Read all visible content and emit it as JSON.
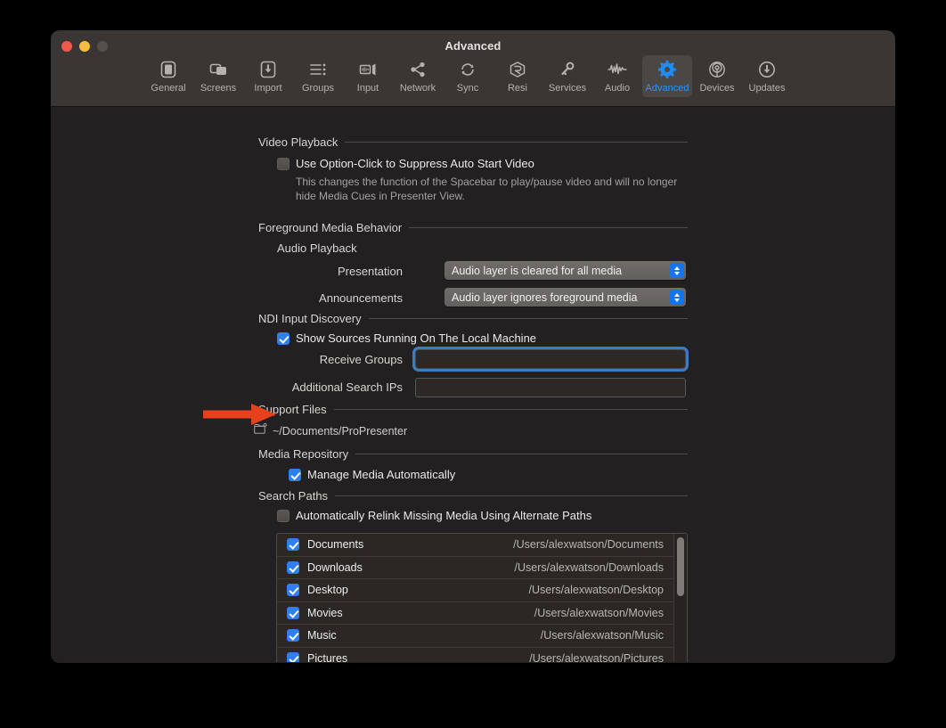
{
  "window": {
    "title": "Advanced",
    "traffic_lights": [
      "close-red",
      "minimize-yellow",
      "zoom-grey"
    ]
  },
  "toolbar": {
    "tabs": [
      {
        "label": "General",
        "icon": "general-icon",
        "selected": false
      },
      {
        "label": "Screens",
        "icon": "screens-icon",
        "selected": false
      },
      {
        "label": "Import",
        "icon": "import-icon",
        "selected": false
      },
      {
        "label": "Groups",
        "icon": "groups-icon",
        "selected": false
      },
      {
        "label": "Input",
        "icon": "input-icon",
        "selected": false
      },
      {
        "label": "Network",
        "icon": "network-icon",
        "selected": false
      },
      {
        "label": "Sync",
        "icon": "sync-icon",
        "selected": false
      },
      {
        "label": "Resi",
        "icon": "resi-icon",
        "selected": false
      },
      {
        "label": "Services",
        "icon": "services-key-icon",
        "selected": false
      },
      {
        "label": "Audio",
        "icon": "audio-waveform-icon",
        "selected": false
      },
      {
        "label": "Advanced",
        "icon": "gear-icon",
        "selected": true
      },
      {
        "label": "Devices",
        "icon": "devices-antenna-icon",
        "selected": false
      },
      {
        "label": "Updates",
        "icon": "updates-download-icon",
        "selected": false
      }
    ],
    "selected_tab": "Advanced"
  },
  "sections": {
    "video_playback": {
      "title": "Video Playback",
      "checkbox_label": "Use Option-Click to Suppress Auto Start Video",
      "checkbox_checked": false,
      "help_text": "This changes the function of the Spacebar to play/pause video and will no longer hide Media Cues in Presenter View."
    },
    "foreground_media": {
      "title": "Foreground Media Behavior",
      "subhead": "Audio Playback",
      "presentation_label": "Presentation",
      "presentation_value": "Audio layer is cleared for all media",
      "announcements_label": "Announcements",
      "announcements_value": "Audio layer ignores foreground media"
    },
    "ndi": {
      "title": "NDI Input Discovery",
      "checkbox_label": "Show Sources Running On The Local Machine",
      "checkbox_checked": true,
      "receive_groups_label": "Receive Groups",
      "receive_groups_value": "",
      "receive_groups_placeholder": "",
      "additional_ips_label": "Additional Search IPs",
      "additional_ips_value": "",
      "additional_ips_placeholder": ""
    },
    "support_files": {
      "title": "Support Files",
      "icon": "folder-badge-icon",
      "path": "~/Documents/ProPresenter"
    },
    "media_repository": {
      "title": "Media Repository",
      "checkbox_label": "Manage Media Automatically",
      "checkbox_checked": true
    },
    "search_paths": {
      "title": "Search Paths",
      "checkbox_label": "Automatically Relink Missing Media Using Alternate Paths",
      "checkbox_checked": false,
      "rows": [
        {
          "checked": true,
          "name": "Documents",
          "path": "/Users/alexwatson/Documents"
        },
        {
          "checked": true,
          "name": "Downloads",
          "path": "/Users/alexwatson/Downloads"
        },
        {
          "checked": true,
          "name": "Desktop",
          "path": "/Users/alexwatson/Desktop"
        },
        {
          "checked": true,
          "name": "Movies",
          "path": "/Users/alexwatson/Movies"
        },
        {
          "checked": true,
          "name": "Music",
          "path": "/Users/alexwatson/Music"
        },
        {
          "checked": true,
          "name": "Pictures",
          "path": "/Users/alexwatson/Pictures"
        }
      ]
    }
  },
  "annotation": {
    "arrow": "right-pointing-arrow",
    "arrow_color": "#e8401c"
  },
  "colors": {
    "accent_blue": "#2f7ff0",
    "tab_selected_text": "#2f92f5",
    "stepper_blue": "#1673e8",
    "focus_ring": "#3d7cbe",
    "toolbar_bg": "#3a3634",
    "content_bg": "#232021",
    "arrow_orange": "#e8401c"
  }
}
